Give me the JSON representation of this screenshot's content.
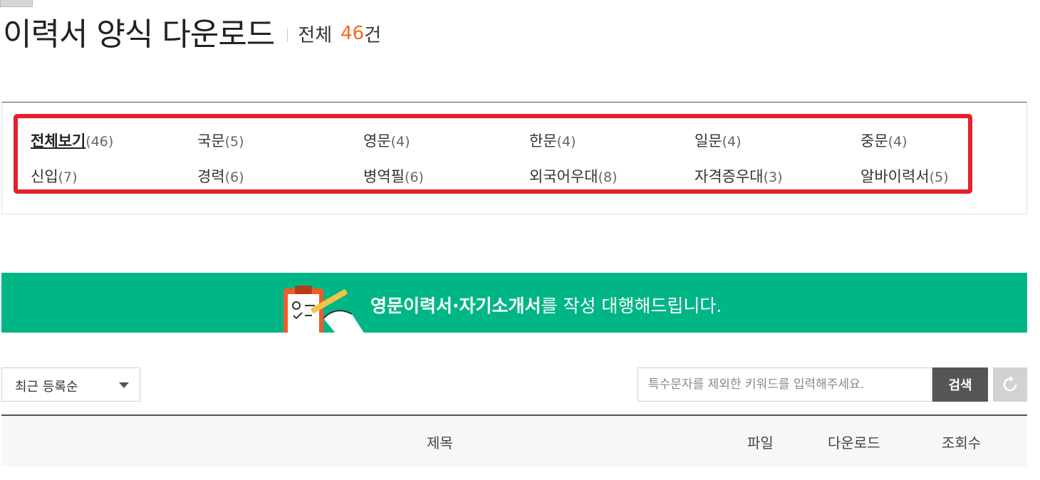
{
  "header": {
    "title": "이력서 양식 다운로드",
    "total_label": "전체",
    "total_count": "46",
    "total_unit": "건"
  },
  "categories": [
    {
      "name": "전체보기",
      "count": "(46)",
      "active": true
    },
    {
      "name": "국문",
      "count": "(5)"
    },
    {
      "name": "영문",
      "count": "(4)"
    },
    {
      "name": "한문",
      "count": "(4)"
    },
    {
      "name": "일문",
      "count": "(4)"
    },
    {
      "name": "중문",
      "count": "(4)"
    },
    {
      "name": "신입",
      "count": "(7)"
    },
    {
      "name": "경력",
      "count": "(6)"
    },
    {
      "name": "병역필",
      "count": "(6)"
    },
    {
      "name": "외국어우대",
      "count": "(8)"
    },
    {
      "name": "자격증우대",
      "count": "(3)"
    },
    {
      "name": "알바이력서",
      "count": "(5)"
    }
  ],
  "banner": {
    "bold_text": "영문이력서·자기소개서",
    "normal_text": "를 작성 대행해드립니다.",
    "color": "#00b686",
    "icon": "clipboard-pencil-icon"
  },
  "toolbar": {
    "sort_value": "최근 등록순",
    "search_placeholder": "특수문자를 제외한 키워드를 입력해주세요.",
    "search_label": "검색",
    "reset_icon": "refresh-icon"
  },
  "table": {
    "columns": [
      "제목",
      "파일",
      "다운로드",
      "조회수"
    ]
  },
  "colors": {
    "accent_orange": "#f26a1b",
    "highlight_red": "#e3212b",
    "banner_green": "#00b686"
  }
}
